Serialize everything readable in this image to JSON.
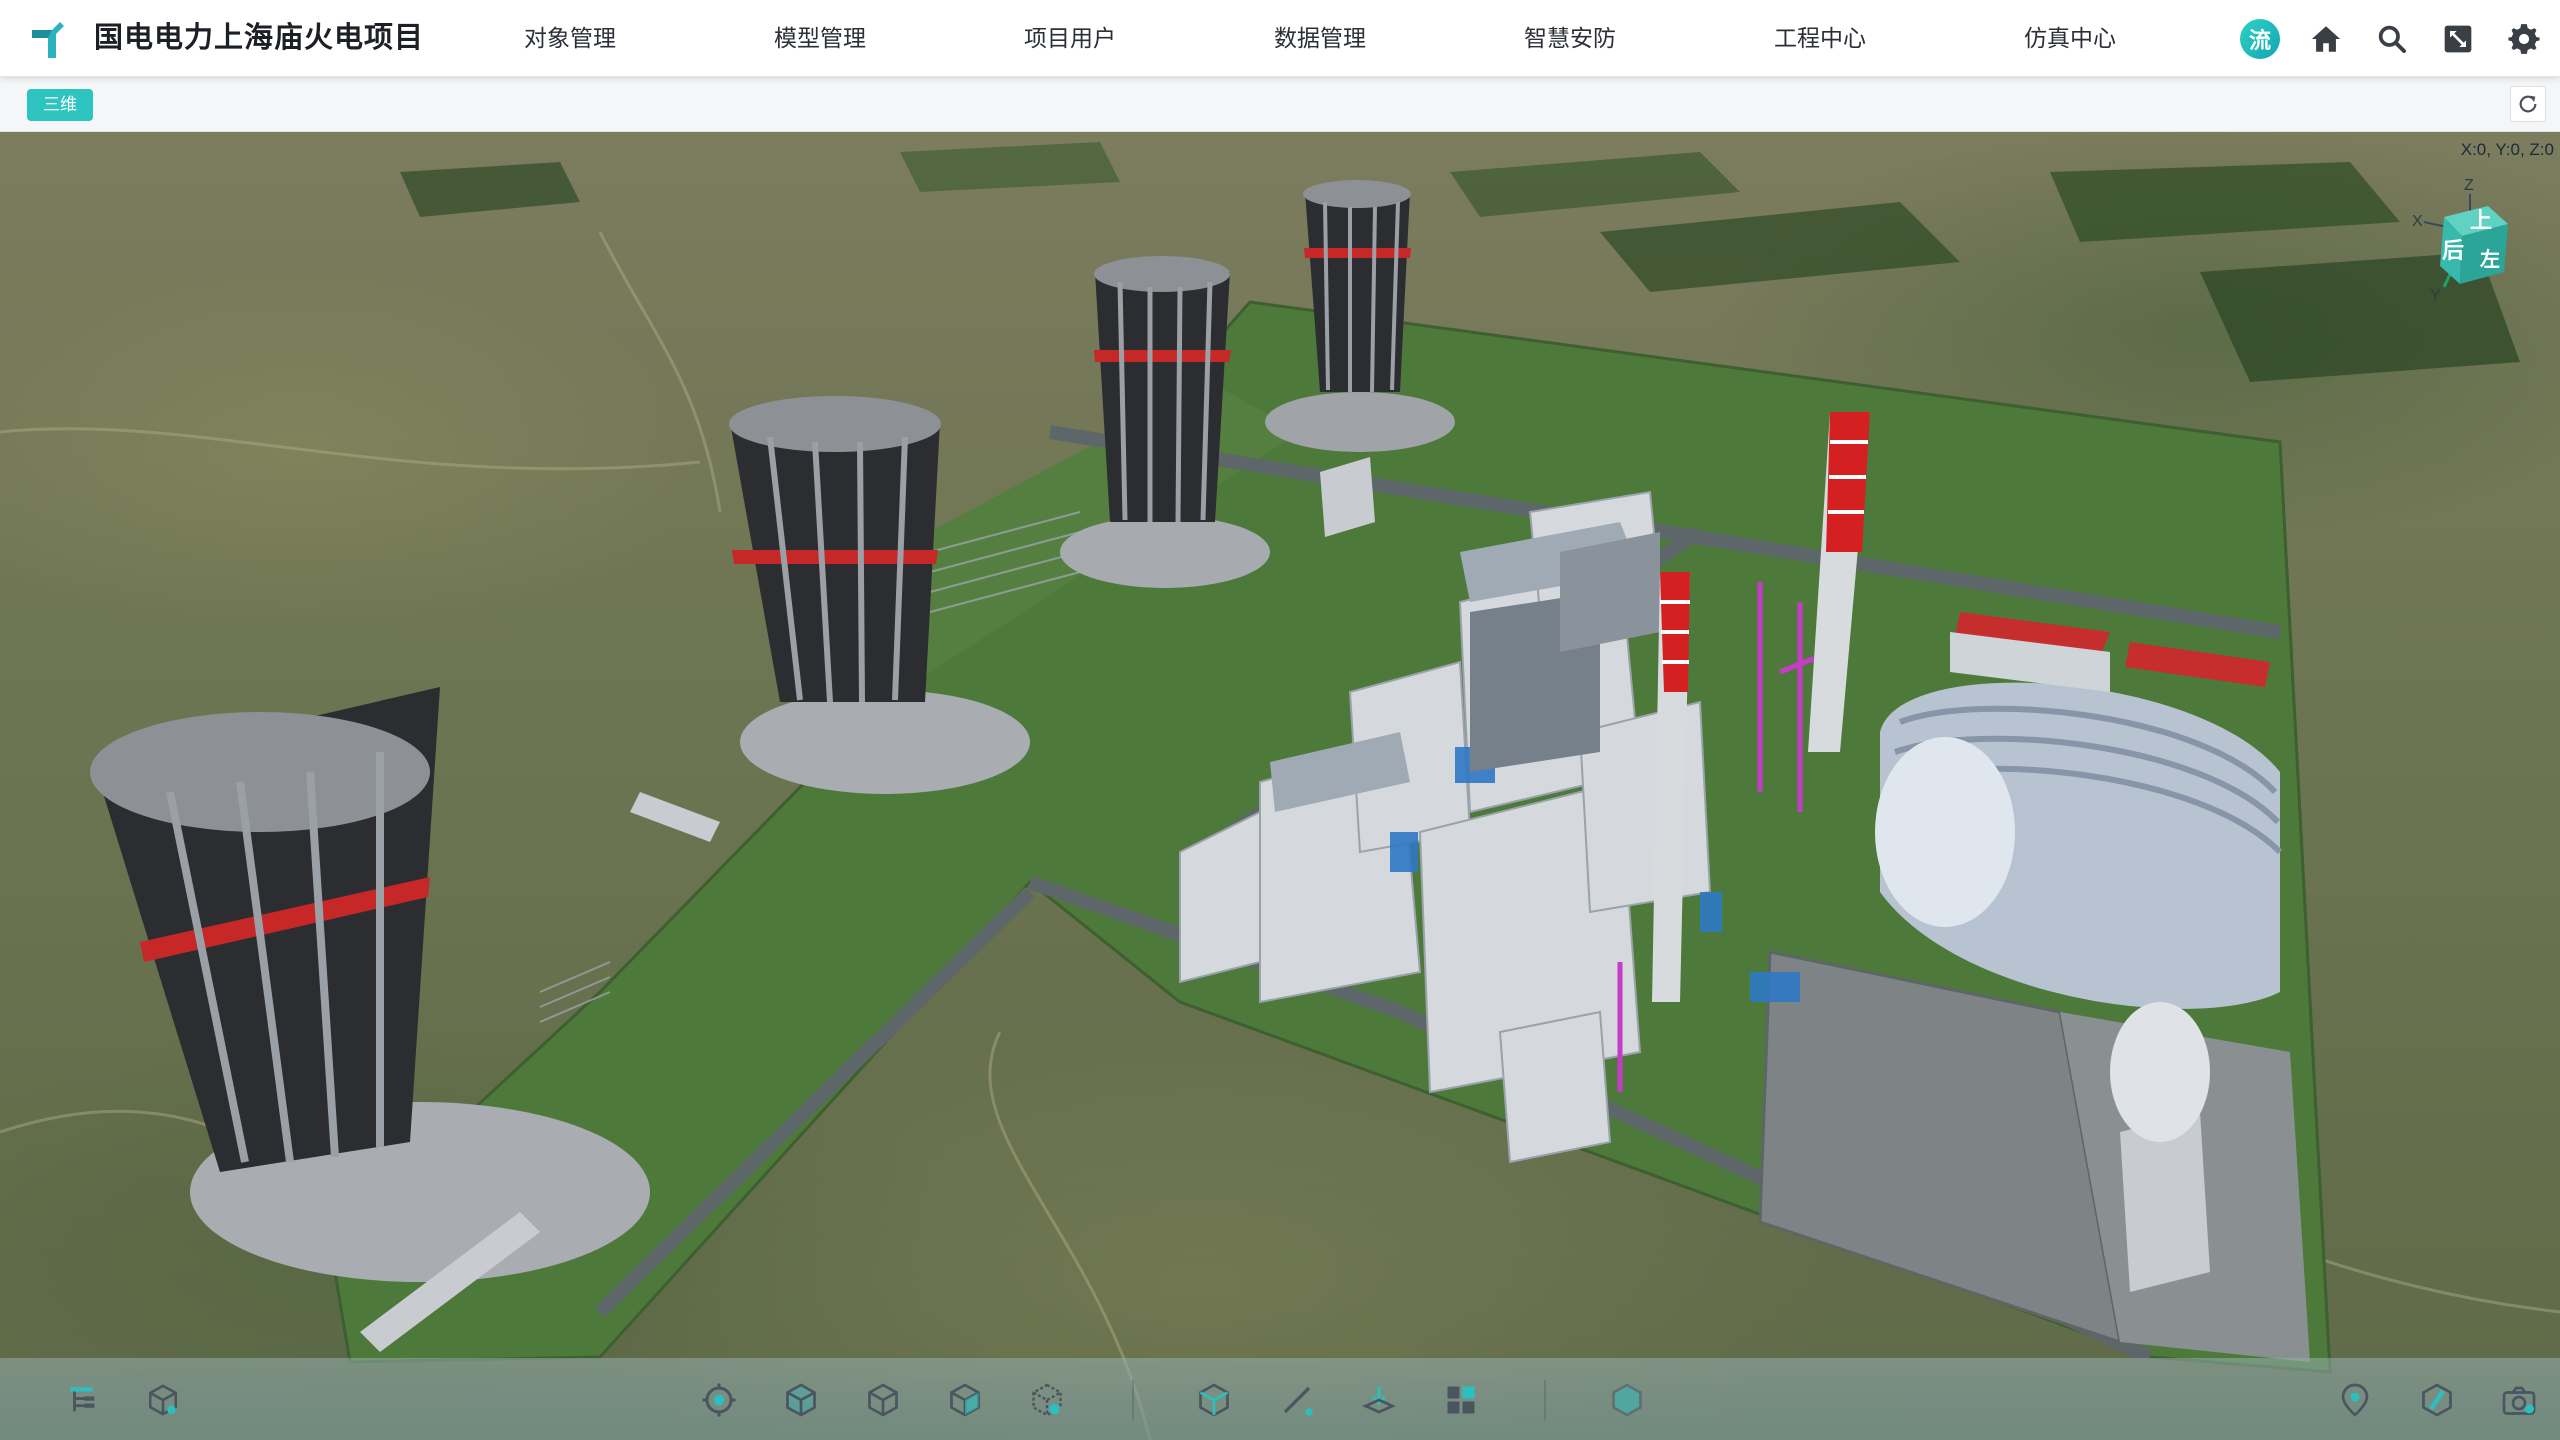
{
  "header": {
    "title": "国电电力上海庙火电项目",
    "nav": [
      {
        "label": "对象管理"
      },
      {
        "label": "模型管理"
      },
      {
        "label": "项目用户"
      },
      {
        "label": "数据管理"
      },
      {
        "label": "智慧安防"
      },
      {
        "label": "工程中心"
      },
      {
        "label": "仿真中心"
      }
    ],
    "flow_badge": "流",
    "icons": [
      "home-icon",
      "search-icon",
      "fullscreen-icon",
      "gear-icon"
    ]
  },
  "subbar": {
    "mode_tag": "三维",
    "refresh_icon": "refresh-icon"
  },
  "viewport": {
    "coord_readout": "X:0, Y:0, Z:0",
    "navcube": {
      "axis_z": "Z",
      "axis_x": "X",
      "axis_y": "Y",
      "top_face": "上",
      "front_face": "后",
      "side_face": "左"
    }
  },
  "toolbar": {
    "left": [
      "tree-icon",
      "model-box-icon"
    ],
    "center": [
      "locate-icon",
      "cube-icon",
      "cube-outline-icon",
      "cube-corner-icon",
      "cube-grid-icon"
    ],
    "tools": [
      "perspective-icon",
      "measure-icon",
      "section-icon",
      "layers-icon"
    ],
    "single": [
      "hexagon-icon"
    ],
    "right": [
      "map-pin-icon",
      "clip-icon",
      "camera-icon"
    ]
  },
  "colors": {
    "accent": "#2ec4c0",
    "ground": "#4d7a3a",
    "stack_red": "#d42020"
  }
}
